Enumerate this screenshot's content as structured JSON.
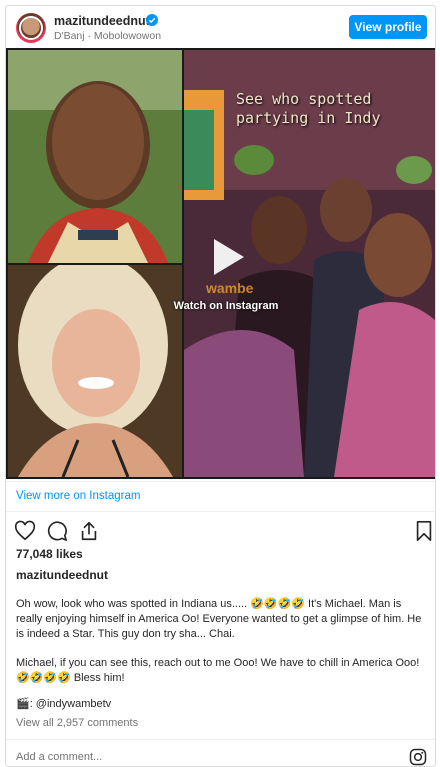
{
  "header": {
    "username": "mazitundeednut",
    "subtitle": "D'Banj · Mobolowowon",
    "view_profile_label": "View profile"
  },
  "media": {
    "overlay_text": "See who spotted partying in Indy",
    "watch_label": "Watch on Instagram"
  },
  "view_more_label": "View more on Instagram",
  "likes": "77,048 likes",
  "caption_username": "mazitundeednut",
  "caption_p1": "Oh wow, look who was spotted in Indiana us..... 🤣🤣🤣🤣 It's Michael. Man is really enjoying himself in America Oo! Everyone wanted to get a glimpse of him. He is indeed a Star. This guy don try sha... Chai.",
  "caption_p2": "Michael, if you can see this, reach out to me Ooo! We have to chill in America Ooo! 🤣🤣🤣🤣 Bless him!",
  "credit": "🎬: @indywambetv",
  "comments_label": "View all 2,957 comments",
  "add_comment_placeholder": "Add a comment...",
  "icons": [
    "verified-icon",
    "play-icon",
    "heart-icon",
    "comment-icon",
    "share-icon",
    "bookmark-icon",
    "instagram-icon"
  ],
  "colors": {
    "accent": "#0095f6",
    "text": "#262626",
    "muted": "#737373"
  }
}
